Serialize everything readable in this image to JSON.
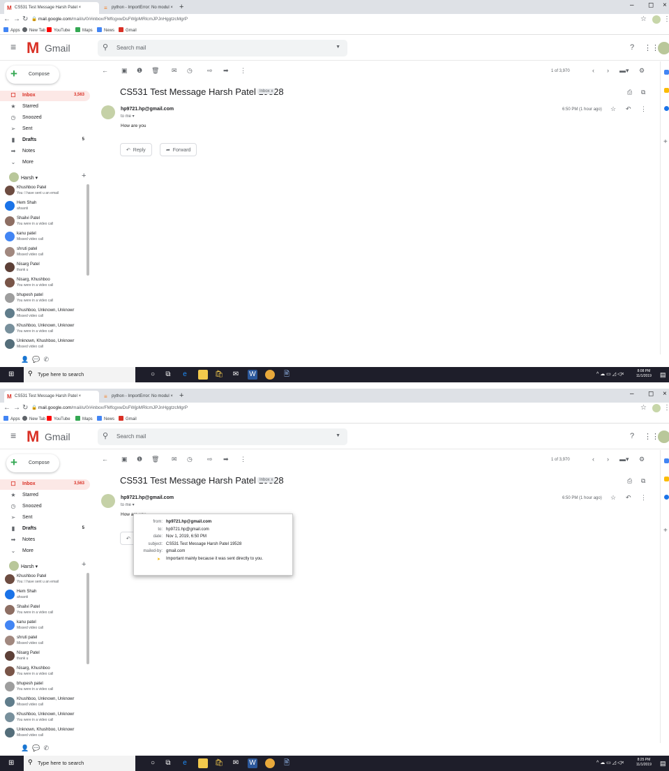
{
  "browser": {
    "tabs": [
      {
        "title": "CS531 Test Message Harsh Patel ×"
      },
      {
        "title": "python - ImportError: No modul ×"
      }
    ],
    "new_tab": "+",
    "minimize": "–",
    "restore": "◻",
    "close": "×",
    "url_host": "mail.google.com",
    "url_path": "/mail/u/0/#inbox/FMfcgxwDsFWjpMRlcmJPJnHggtzcMgrP",
    "bookmarks": [
      "Apps",
      "New Tab",
      "YouTube",
      "Maps",
      "News",
      "Gmail"
    ]
  },
  "gmail": {
    "logo_text": "Gmail",
    "search_placeholder": "Search mail",
    "compose": "Compose",
    "sidebar": [
      {
        "label": "Inbox",
        "count": "3,563"
      },
      {
        "label": "Starred",
        "count": ""
      },
      {
        "label": "Snoozed",
        "count": ""
      },
      {
        "label": "Sent",
        "count": ""
      },
      {
        "label": "Drafts",
        "count": "5"
      },
      {
        "label": "Notes",
        "count": ""
      },
      {
        "label": "More",
        "count": ""
      }
    ],
    "hangouts_user": "Harsh",
    "contacts": [
      {
        "name": "Khushboo Patel",
        "status": "You: I have sent u an email"
      },
      {
        "name": "Hem Shah",
        "status": "ahsanti"
      },
      {
        "name": "Shailvi Patel",
        "status": "You were in a video call"
      },
      {
        "name": "kanu patel",
        "status": "Missed video call"
      },
      {
        "name": "shruti patel",
        "status": "Missed video call"
      },
      {
        "name": "Nisarg Patel",
        "status": "thank u"
      },
      {
        "name": "Nisarg, Khushboo",
        "status": "You were in a video call"
      },
      {
        "name": "bhupesh patel",
        "status": "You were in a video call"
      },
      {
        "name": "Khushboo, Unknown, Unknowr",
        "status": "Missed video call"
      },
      {
        "name": "Khushboo, Unknown, Unknowr",
        "status": "You were in a video call"
      },
      {
        "name": "Unknown, Khushboo, Unknowr",
        "status": "Missed video call"
      }
    ],
    "pagination": "1 of 3,970",
    "subject": "CS531 Test Message Harsh Patel 19528",
    "label_chip": "Inbox x",
    "sender": "hp9721.hp@gmail.com",
    "to_me": "to me",
    "time": "6:50 PM (1 hour ago)",
    "body": "How are you",
    "reply": "Reply",
    "forward": "Forward"
  },
  "taskbar": {
    "search_placeholder": "Type here to search",
    "clock_time_1": "8:08 PM",
    "clock_time_2": "8:25 PM",
    "clock_date": "11/1/2019"
  },
  "details_popup": {
    "rows": [
      {
        "key": "from:",
        "value": "hp9721.hp@gmail.com"
      },
      {
        "key": "to:",
        "value": "hp9721.hp@gmail.com"
      },
      {
        "key": "date:",
        "value": "Nov 1, 2019, 6:50 PM"
      },
      {
        "key": "subject:",
        "value": "CS531 Test Message Harsh Patel 19528"
      },
      {
        "key": "mailed-by:",
        "value": "gmail.com"
      }
    ],
    "important_note": "Important mainly because it was sent directly to you."
  },
  "colors": {
    "gmail_red": "#d93025",
    "inbox_bg": "#fce8e6",
    "taskbar": "#1e1e2a"
  }
}
